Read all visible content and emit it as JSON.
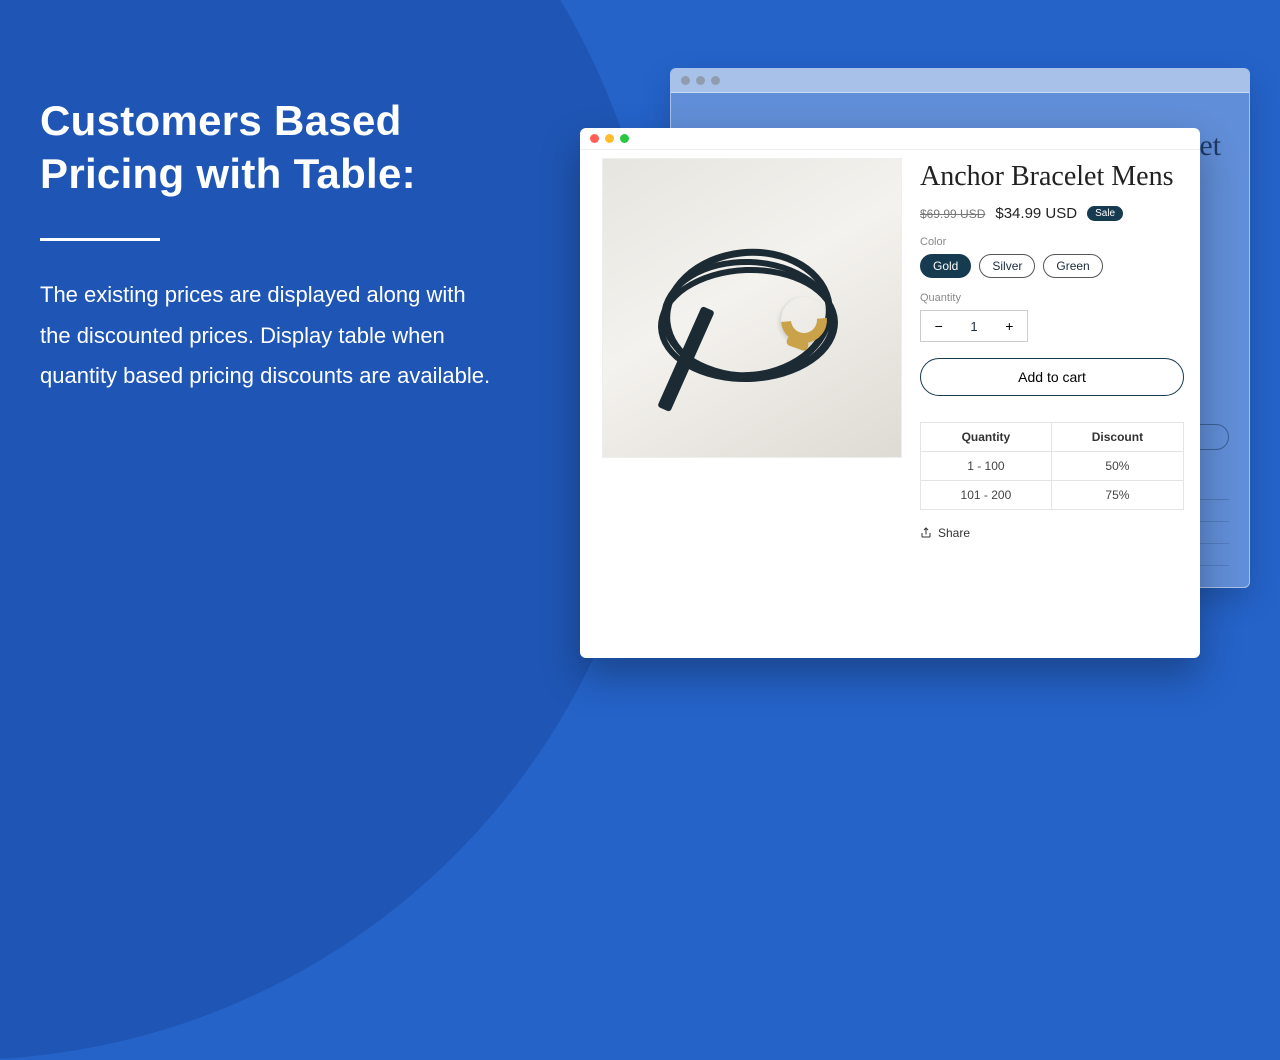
{
  "marketing": {
    "headline": "Customers Based Pricing with Table:",
    "body": "The existing prices are displayed along with the discounted prices. Display table when quantity based pricing discounts are available."
  },
  "back_window": {
    "title": "Anchor Bracelet"
  },
  "product": {
    "title": "Anchor Bracelet Mens",
    "old_price": "$69.99 USD",
    "new_price": "$34.99 USD",
    "sale_badge": "Sale",
    "color_label": "Color",
    "colors": [
      {
        "label": "Gold",
        "selected": true
      },
      {
        "label": "Silver",
        "selected": false
      },
      {
        "label": "Green",
        "selected": false
      }
    ],
    "quantity_label": "Quantity",
    "quantity_value": "1",
    "add_to_cart": "Add to cart",
    "discount_table": {
      "headers": [
        "Quantity",
        "Discount"
      ],
      "rows": [
        [
          "1 - 100",
          "50%"
        ],
        [
          "101 - 200",
          "75%"
        ]
      ]
    },
    "share_label": "Share"
  }
}
